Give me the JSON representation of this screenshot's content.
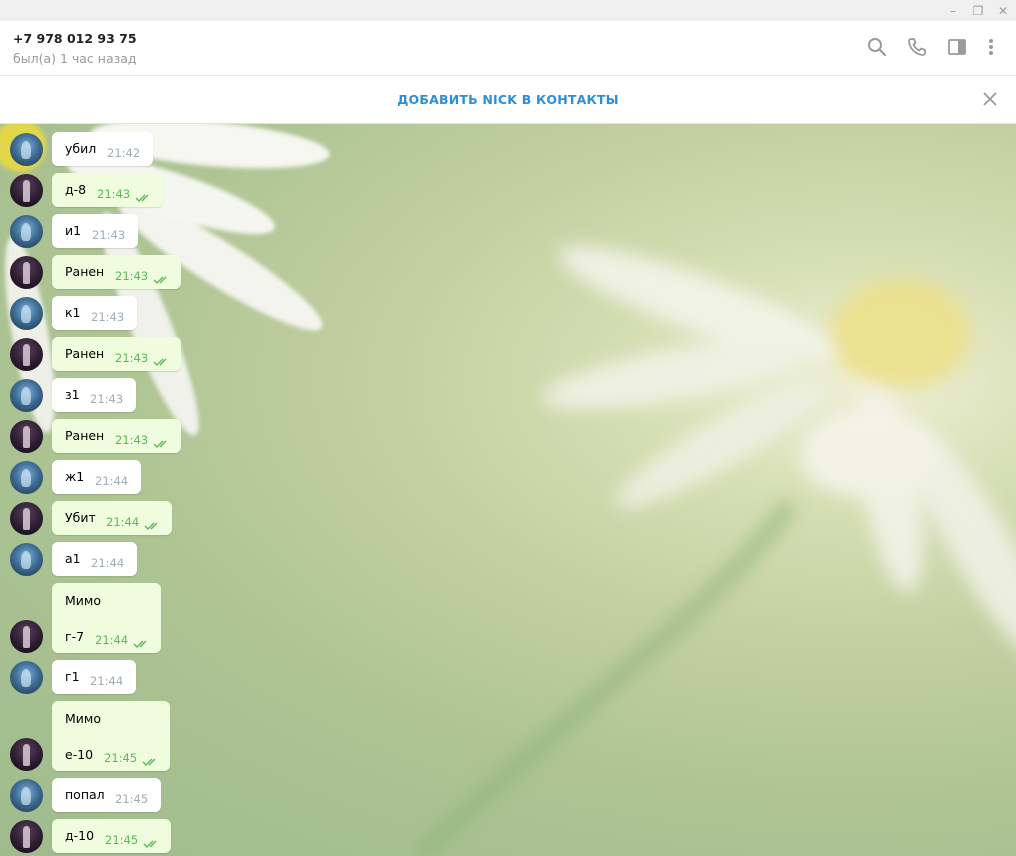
{
  "window": {
    "minimize_glyph": "–",
    "restore_glyph": "❐",
    "close_glyph": "✕"
  },
  "header": {
    "contact_name": "+7 978 012 93 75",
    "status": "был(а) 1 час назад",
    "icons": [
      "search-icon",
      "phone-icon",
      "sidebar-icon",
      "more-icon"
    ]
  },
  "add_contact": {
    "label": "ДОБАВИТЬ NICK В КОНТАКТЫ"
  },
  "colors": {
    "accent": "#2d8fd5",
    "out_bubble": "#effdde",
    "in_bubble": "#ffffff",
    "out_time": "#5fb75a",
    "in_time": "#a0acb6"
  },
  "messages": [
    {
      "dir": "in",
      "text": "убил",
      "time": "21:42"
    },
    {
      "dir": "out",
      "text": "д-8",
      "time": "21:43"
    },
    {
      "dir": "in",
      "text": "и1",
      "time": "21:43"
    },
    {
      "dir": "out",
      "text": "Ранен",
      "time": "21:43"
    },
    {
      "dir": "in",
      "text": "к1",
      "time": "21:43"
    },
    {
      "dir": "out",
      "text": "Ранен",
      "time": "21:43"
    },
    {
      "dir": "in",
      "text": "з1",
      "time": "21:43"
    },
    {
      "dir": "out",
      "text": "Ранен",
      "time": "21:43"
    },
    {
      "dir": "in",
      "text": "ж1",
      "time": "21:44"
    },
    {
      "dir": "out",
      "text": "Убит",
      "time": "21:44"
    },
    {
      "dir": "in",
      "text": "а1",
      "time": "21:44"
    },
    {
      "dir": "out",
      "lines": [
        "Мимо",
        "г-7"
      ],
      "time": "21:44"
    },
    {
      "dir": "in",
      "text": "г1",
      "time": "21:44"
    },
    {
      "dir": "out",
      "lines": [
        "Мимо",
        "е-10"
      ],
      "time": "21:45"
    },
    {
      "dir": "in",
      "text": "попал",
      "time": "21:45"
    },
    {
      "dir": "out",
      "text": "д-10",
      "time": "21:45"
    }
  ]
}
